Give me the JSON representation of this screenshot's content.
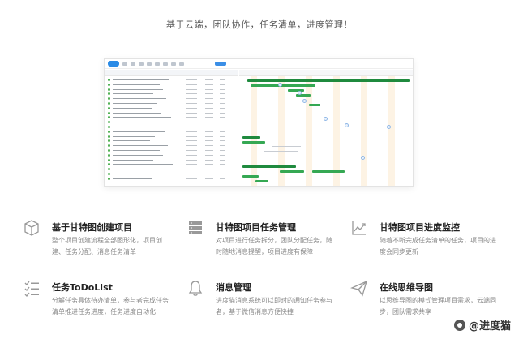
{
  "tagline": "基于云端，团队协作，任务清单，进度管理！",
  "screenshot": {
    "app_name": "gantt-app-preview"
  },
  "features": [
    {
      "icon": "cube-icon",
      "title": "基于甘特图创建项目",
      "desc": "整个项目创建流程全部图形化，项目创建、任务分配、消息任务清单"
    },
    {
      "icon": "server-stack-icon",
      "title": "甘特图项目任务管理",
      "desc": "对项目进行任务拆分，团队分配任务，随时随地消息提醒，项目进度有保障"
    },
    {
      "icon": "trend-chart-icon",
      "title": "甘特图项目进度监控",
      "desc": "随着不断完成任务清单的任务，项目的进度会同步更新"
    },
    {
      "icon": "checklist-icon",
      "title": "任务ToDoList",
      "desc": "分解任务具体待办清单，参与者完成任务清单推进任务进度，任务进度自动化"
    },
    {
      "icon": "bell-icon",
      "title": "消息管理",
      "desc": "进度猫消息系统可以即时的通知任务参与者，基于微信消息方便快捷"
    },
    {
      "icon": "paper-plane-icon",
      "title": "在线思维导图",
      "desc": "以思维导图的模式管理项目需求，云端同步，团队需求共享"
    }
  ],
  "watermark": {
    "text": "@进度猫"
  },
  "colors": {
    "accent": "#2b8be6",
    "bar": "#35a853",
    "bar_dark": "#1f8a3e",
    "weekend": "#fdf3e4"
  }
}
